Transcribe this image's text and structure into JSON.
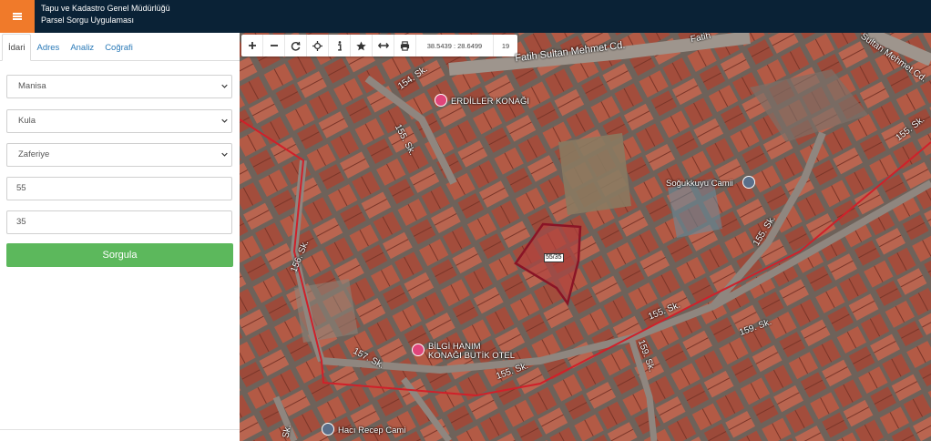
{
  "header": {
    "org": "Tapu ve Kadastro Genel Müdürlüğü",
    "app": "Parsel Sorgu Uygulaması",
    "menu_icon": "hamburger-icon",
    "colors": {
      "bar": "#0a2236",
      "menu": "#f07a2a"
    }
  },
  "sidebar": {
    "tabs": [
      {
        "label": "İdari",
        "active": true
      },
      {
        "label": "Adres",
        "active": false
      },
      {
        "label": "Analiz",
        "active": false
      },
      {
        "label": "Coğrafi",
        "active": false
      }
    ],
    "province": "Manisa",
    "district": "Kula",
    "neighborhood": "Zaferiye",
    "block_no": "55",
    "parcel_no": "35",
    "query_button": "Sorgula",
    "query_button_color": "#5cb85c"
  },
  "map": {
    "toolbar": {
      "icons": [
        "zoom-in-icon",
        "zoom-out-icon",
        "refresh-icon",
        "locate-icon",
        "info-icon",
        "star-icon",
        "measure-icon",
        "print-icon"
      ],
      "coordinates": "38.5439 : 28.6499",
      "zoom": "19"
    },
    "streets": [
      "Fatih Sultan Mehmet Cd.",
      "Fatih",
      "Sultan Mehmet Cd.",
      "154. Sk.",
      "155. Sk.",
      "155. Sk.",
      "156. Sk.",
      "155. Sk.",
      "155. Sk.",
      "157. Sk.",
      "159. Sk.",
      "159. Sk.",
      "Sk."
    ],
    "pois": [
      {
        "label": "ERDİLLER KONAĞI",
        "color": "#e0457b",
        "icon": "hotel-icon"
      },
      {
        "label": "Soğukkuyu Camii",
        "color": "#5a6f8a",
        "icon": "mosque-icon"
      },
      {
        "label": "BİLGİ HANIM",
        "label2": "KONAĞI BUTİK OTEL",
        "color": "#e0457b",
        "icon": "hotel-icon"
      },
      {
        "label": "Hacı Recep Cami",
        "color": "#5a6f8a",
        "icon": "mosque-icon"
      }
    ],
    "parcel_label": "55/35",
    "parcel_color": "#8a1426",
    "boundary_color": "#d0202a"
  }
}
